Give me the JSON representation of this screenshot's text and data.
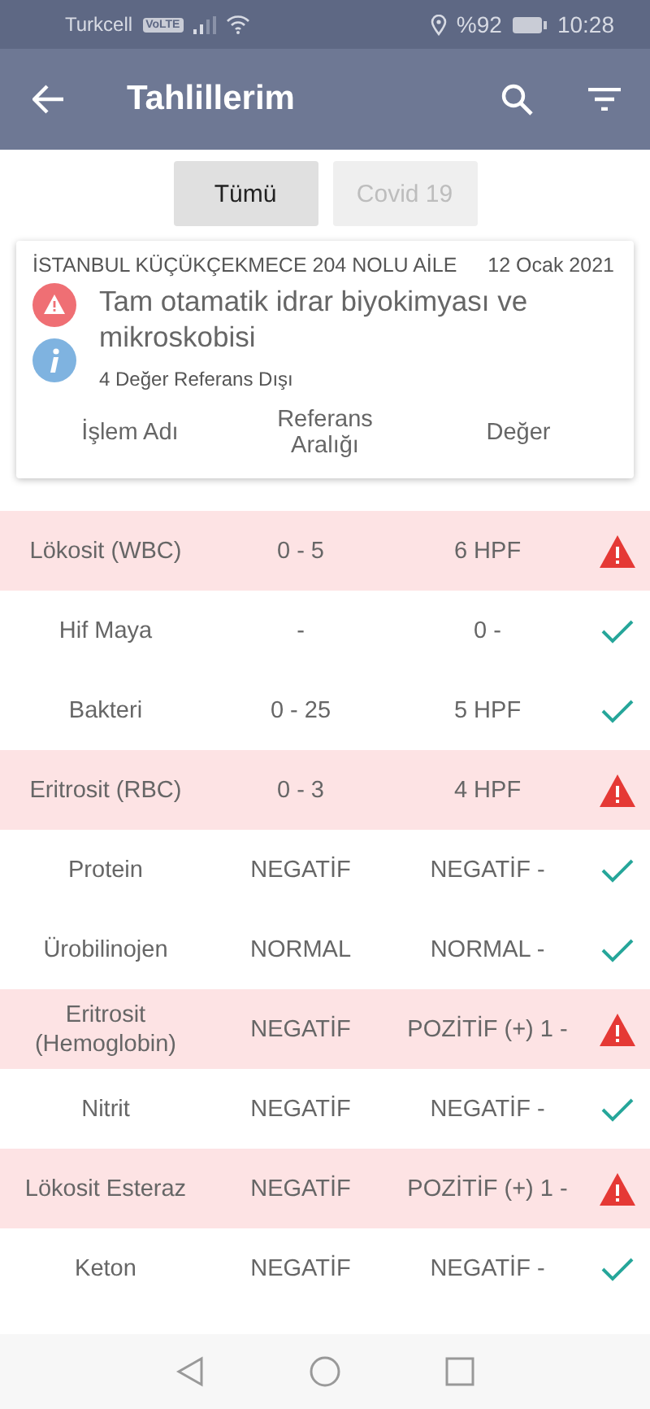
{
  "status_bar": {
    "carrier": "Turkcell",
    "volte": "VoLTE",
    "battery": "%92",
    "time": "10:28"
  },
  "app_bar": {
    "title": "Tahlillerim"
  },
  "tabs": [
    {
      "label": "Tümü",
      "selected": true
    },
    {
      "label": "Covid 19",
      "selected": false
    }
  ],
  "card": {
    "institution": "İSTANBUL KÜÇÜKÇEKMECE 204 NOLU AİLE",
    "date": "12 Ocak 2021",
    "title": "Tam otamatik idrar biyokimyası ve mikroskobisi",
    "summary": "4 Değer Referans Dışı",
    "columns": [
      "İşlem Adı",
      "Referans Aralığı",
      "Değer"
    ]
  },
  "rows": [
    {
      "name": "Lökosit (WBC)",
      "range": "0 - 5",
      "value": "6 HPF",
      "flagged": true
    },
    {
      "name": "Hif Maya",
      "range": "-",
      "value": "0 -",
      "flagged": false
    },
    {
      "name": "Bakteri",
      "range": "0 - 25",
      "value": "5 HPF",
      "flagged": false
    },
    {
      "name": "Eritrosit (RBC)",
      "range": "0 - 3",
      "value": "4 HPF",
      "flagged": true
    },
    {
      "name": "Protein",
      "range": "NEGATİF",
      "value": "NEGATİF -",
      "flagged": false
    },
    {
      "name": "Ürobilinojen",
      "range": "NORMAL",
      "value": "NORMAL -",
      "flagged": false
    },
    {
      "name": "Eritrosit (Hemoglobin)",
      "range": "NEGATİF",
      "value": "POZİTİF (+) 1 -",
      "flagged": true
    },
    {
      "name": "Nitrit",
      "range": "NEGATİF",
      "value": "NEGATİF -",
      "flagged": false
    },
    {
      "name": "Lökosit Esteraz",
      "range": "NEGATİF",
      "value": "POZİTİF (+) 1 -",
      "flagged": true
    },
    {
      "name": "Keton",
      "range": "NEGATİF",
      "value": "NEGATİF -",
      "flagged": false
    }
  ]
}
